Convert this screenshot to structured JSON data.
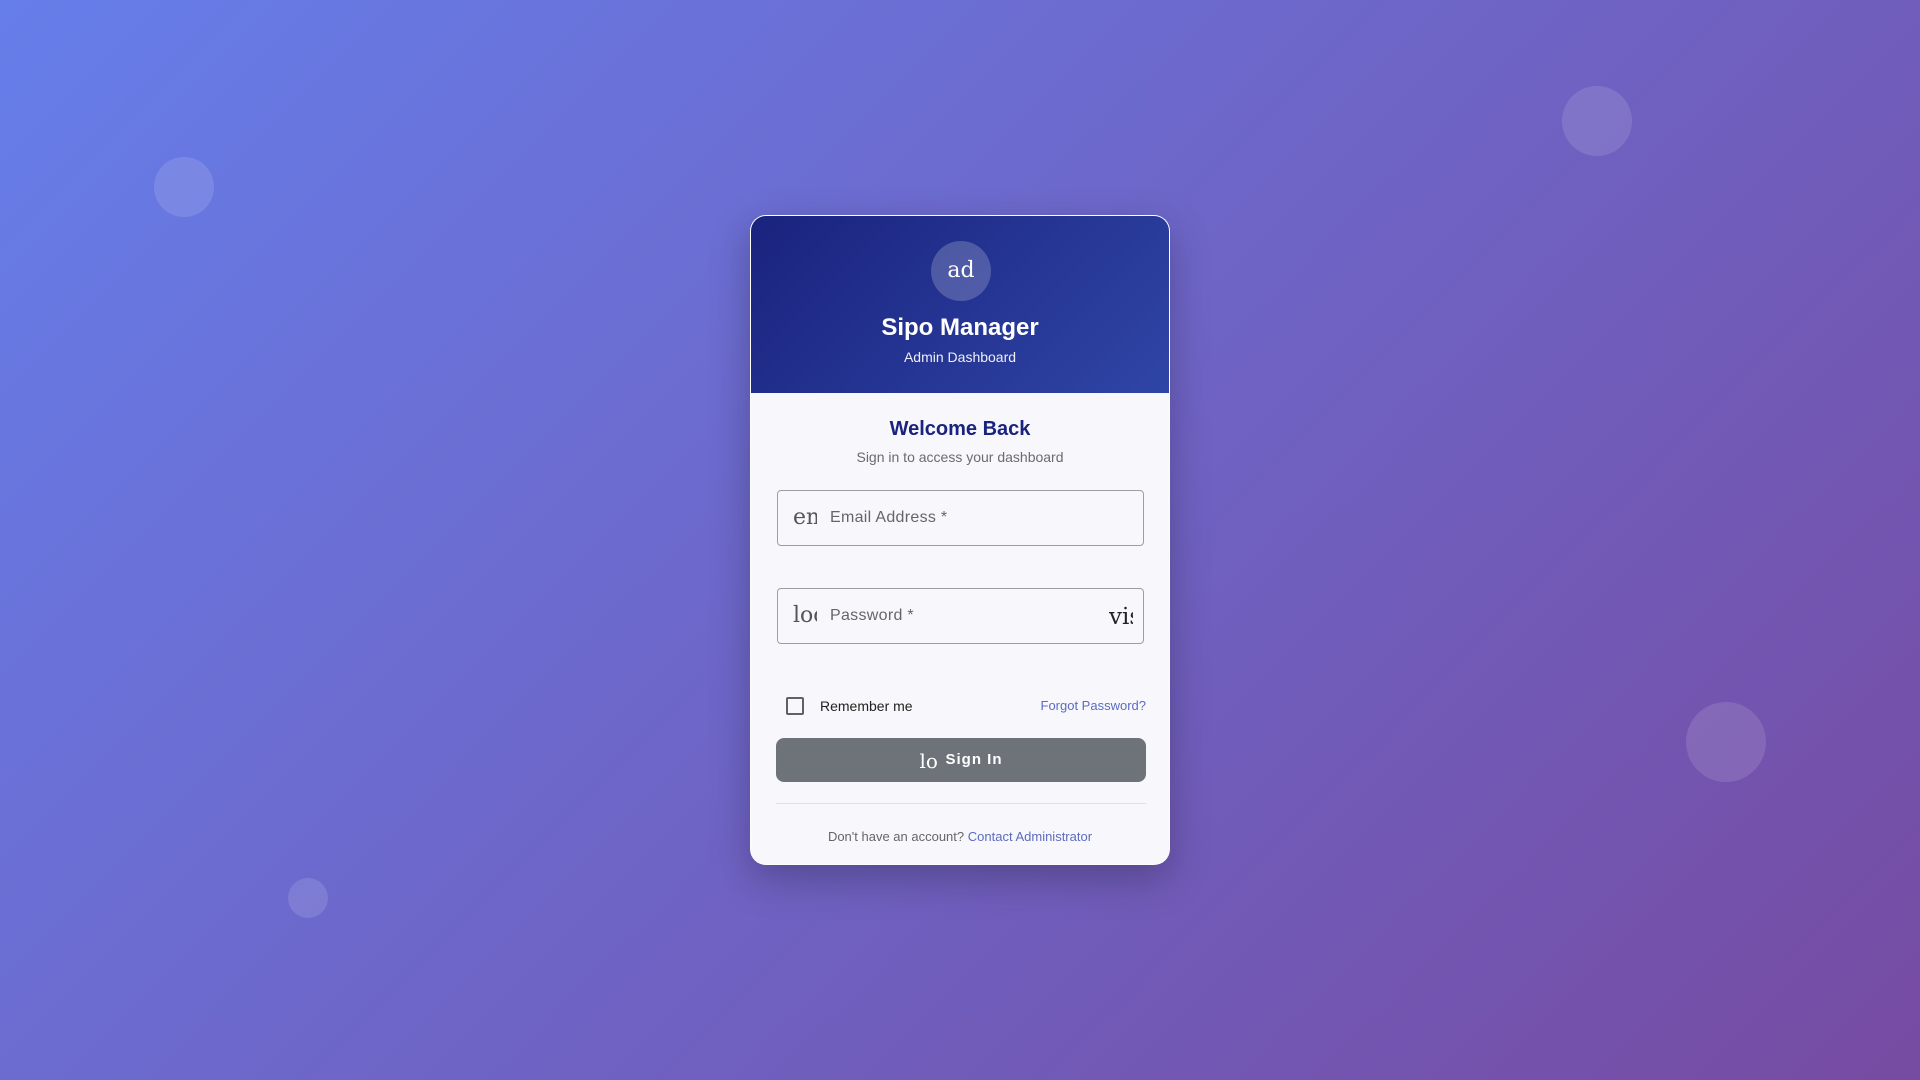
{
  "background": {
    "gradient_start": "#667eea",
    "gradient_end": "#764ba2"
  },
  "header": {
    "avatar_icon": "ad",
    "avatar_icon_name": "admin-icon",
    "title": "Sipo Manager",
    "subtitle": "Admin Dashboard",
    "gradient_start": "#1a237e",
    "gradient_end": "#2f45a6"
  },
  "welcome": {
    "title": "Welcome Back",
    "subtitle": "Sign in to access your dashboard"
  },
  "form": {
    "email": {
      "icon": "email",
      "icon_name": "email-icon",
      "placeholder": "Email Address *",
      "value": ""
    },
    "password": {
      "icon": "lock",
      "icon_name": "lock-icon",
      "placeholder": "Password *",
      "value": "",
      "toggle_icon": "visibility",
      "toggle_icon_name": "visibility-icon"
    },
    "remember_label": "Remember me",
    "remember_checked": false,
    "forgot_label": "Forgot Password?",
    "submit": {
      "icon": "login",
      "icon_name": "login-icon",
      "label": "Sign In",
      "color": "#6e7379"
    }
  },
  "footer": {
    "prompt": "Don't have an account?",
    "link_label": "Contact Administrator",
    "link_color": "#5c6bc0"
  }
}
